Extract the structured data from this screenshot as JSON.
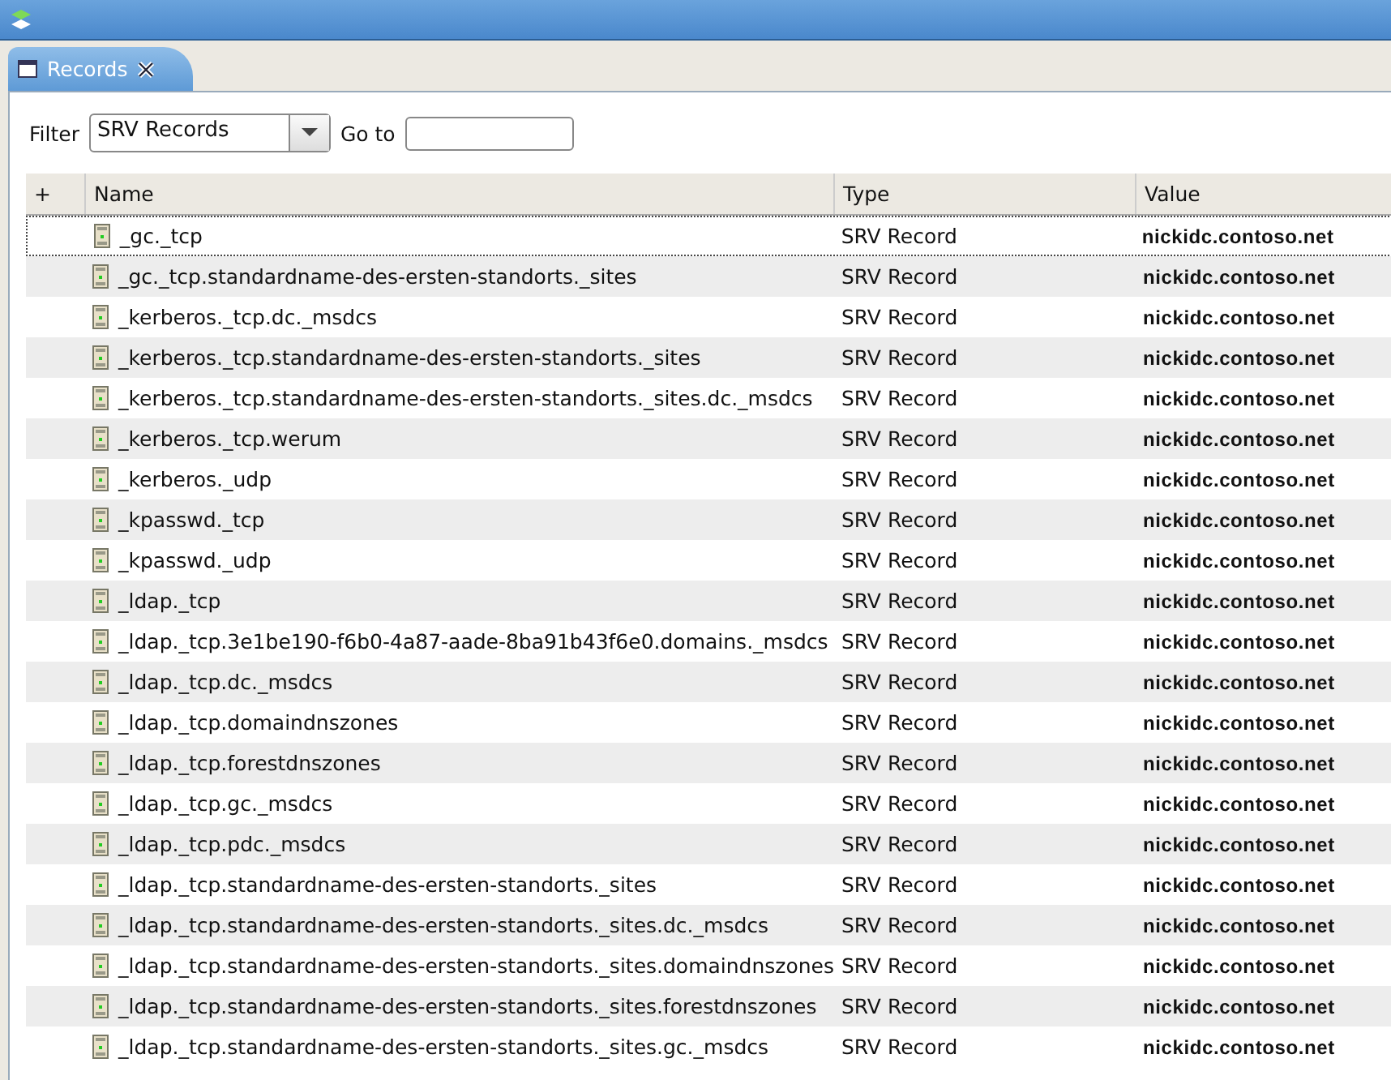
{
  "tabs": [
    {
      "label": "Records",
      "selected": true
    }
  ],
  "filter": {
    "label": "Filter",
    "value": "SRV Records",
    "goto_label": "Go to"
  },
  "table": {
    "columns": [
      "+",
      "Name",
      "Type",
      "Value"
    ],
    "rows": [
      {
        "name": "_gc._tcp",
        "type": "SRV Record",
        "value": "nickidc.contoso.net",
        "selected": true
      },
      {
        "name": "_gc._tcp.standardname-des-ersten-standorts._sites",
        "type": "SRV Record",
        "value": "nickidc.contoso.net",
        "selected": false
      },
      {
        "name": "_kerberos._tcp.dc._msdcs",
        "type": "SRV Record",
        "value": "nickidc.contoso.net",
        "selected": false
      },
      {
        "name": "_kerberos._tcp.standardname-des-ersten-standorts._sites",
        "type": "SRV Record",
        "value": "nickidc.contoso.net",
        "selected": false
      },
      {
        "name": "_kerberos._tcp.standardname-des-ersten-standorts._sites.dc._msdcs",
        "type": "SRV Record",
        "value": "nickidc.contoso.net",
        "selected": false
      },
      {
        "name": "_kerberos._tcp.werum",
        "type": "SRV Record",
        "value": "nickidc.contoso.net",
        "selected": false
      },
      {
        "name": "_kerberos._udp",
        "type": "SRV Record",
        "value": "nickidc.contoso.net",
        "selected": false
      },
      {
        "name": "_kpasswd._tcp",
        "type": "SRV Record",
        "value": "nickidc.contoso.net",
        "selected": false
      },
      {
        "name": "_kpasswd._udp",
        "type": "SRV Record",
        "value": "nickidc.contoso.net",
        "selected": false
      },
      {
        "name": "_ldap._tcp",
        "type": "SRV Record",
        "value": "nickidc.contoso.net",
        "selected": false
      },
      {
        "name": "_ldap._tcp.3e1be190-f6b0-4a87-aade-8ba91b43f6e0.domains._msdcs",
        "type": "SRV Record",
        "value": "nickidc.contoso.net",
        "selected": false
      },
      {
        "name": "_ldap._tcp.dc._msdcs",
        "type": "SRV Record",
        "value": "nickidc.contoso.net",
        "selected": false
      },
      {
        "name": "_ldap._tcp.domaindnszones",
        "type": "SRV Record",
        "value": "nickidc.contoso.net",
        "selected": false
      },
      {
        "name": "_ldap._tcp.forestdnszones",
        "type": "SRV Record",
        "value": "nickidc.contoso.net",
        "selected": false
      },
      {
        "name": "_ldap._tcp.gc._msdcs",
        "type": "SRV Record",
        "value": "nickidc.contoso.net",
        "selected": false
      },
      {
        "name": "_ldap._tcp.pdc._msdcs",
        "type": "SRV Record",
        "value": "nickidc.contoso.net",
        "selected": false
      },
      {
        "name": "_ldap._tcp.standardname-des-ersten-standorts._sites",
        "type": "SRV Record",
        "value": "nickidc.contoso.net",
        "selected": false
      },
      {
        "name": "_ldap._tcp.standardname-des-ersten-standorts._sites.dc._msdcs",
        "type": "SRV Record",
        "value": "nickidc.contoso.net",
        "selected": false
      },
      {
        "name": "_ldap._tcp.standardname-des-ersten-standorts._sites.domaindnszones",
        "type": "SRV Record",
        "value": "nickidc.contoso.net",
        "selected": false
      },
      {
        "name": "_ldap._tcp.standardname-des-ersten-standorts._sites.forestdnszones",
        "type": "SRV Record",
        "value": "nickidc.contoso.net",
        "selected": false
      },
      {
        "name": "_ldap._tcp.standardname-des-ersten-standorts._sites.gc._msdcs",
        "type": "SRV Record",
        "value": "nickidc.contoso.net",
        "selected": false
      }
    ]
  }
}
